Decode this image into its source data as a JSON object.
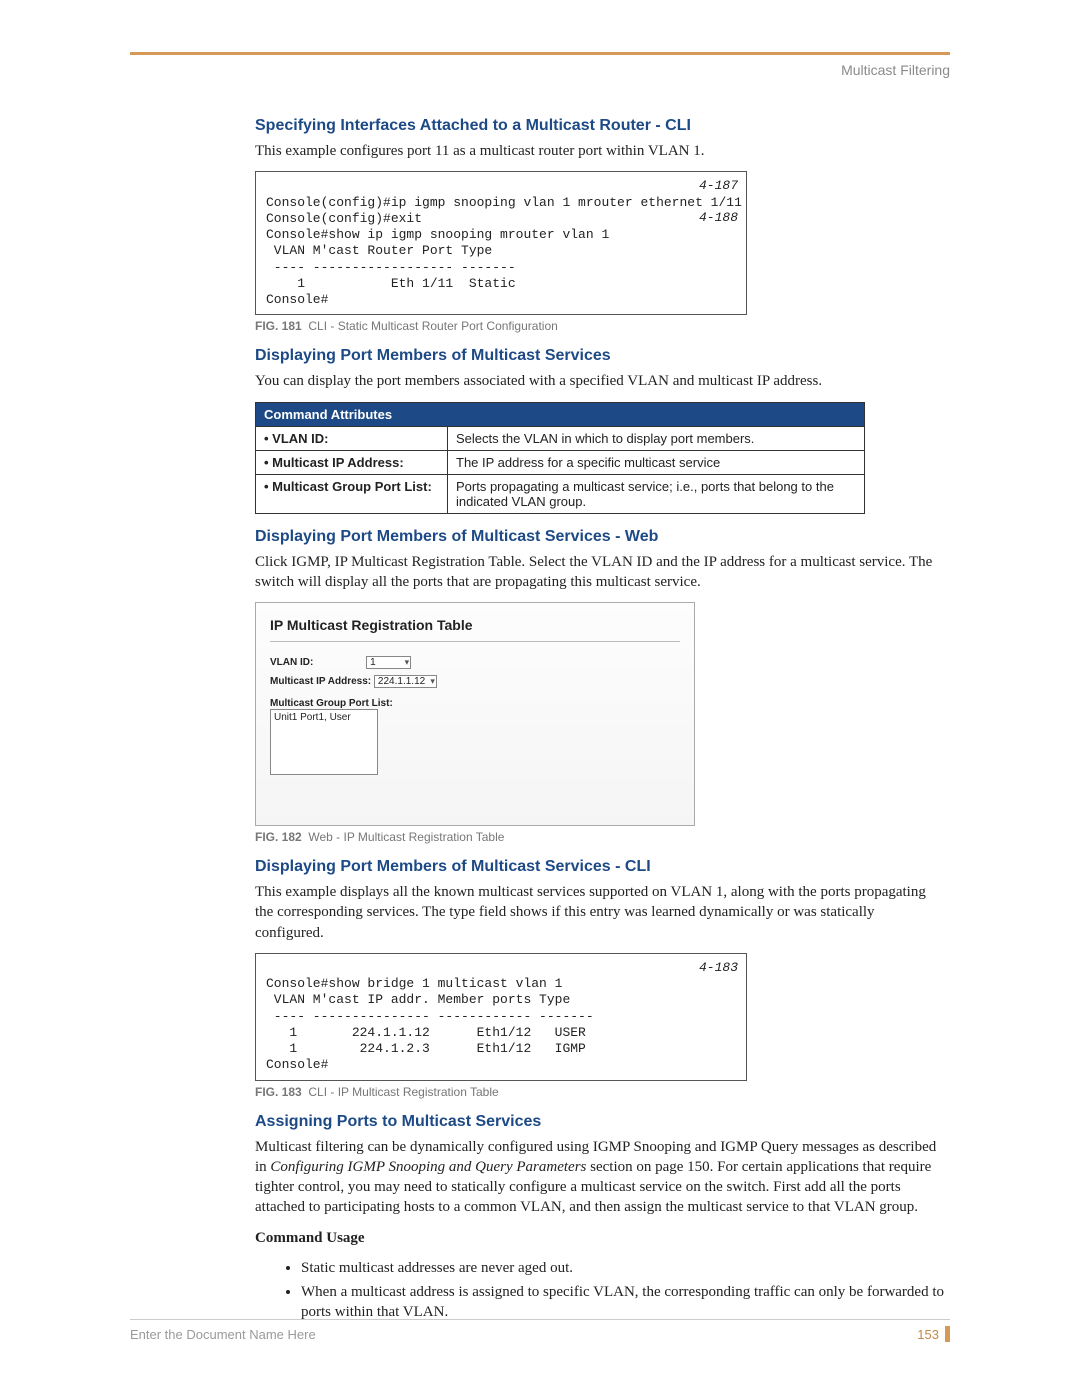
{
  "header": {
    "section": "Multicast Filtering"
  },
  "sec1": {
    "title": "Specifying Interfaces Attached to a Multicast Router - CLI",
    "intro": "This example configures port 11 as a multicast router port within VLAN 1.",
    "code": {
      "l1": "Console(config)#ip igmp snooping vlan 1 mrouter ethernet 1/11",
      "r1": "4-187",
      "l2": "Console(config)#exit",
      "l3": "Console#show ip igmp snooping mrouter vlan 1",
      "r3": "4-188",
      "l4": " VLAN M'cast Router Port Type",
      "l5": " ---- ------------------ -------",
      "l6": "    1           Eth 1/11  Static",
      "l7": "Console#"
    },
    "fig": {
      "no": "FIG. 181",
      "cap": "CLI - Static Multicast Router Port Configuration"
    }
  },
  "sec2": {
    "title": "Displaying Port Members of Multicast Services",
    "intro": "You can display the port members associated with a specified VLAN and multicast IP address.",
    "tableHeader": "Command Attributes",
    "rows": [
      {
        "label": "• VLAN ID:",
        "desc": "Selects the VLAN in which to display port members."
      },
      {
        "label": "• Multicast IP Address:",
        "desc": "The IP address for a specific multicast service"
      },
      {
        "label": "• Multicast Group Port List:",
        "desc": "Ports propagating a multicast service; i.e., ports that belong to the indicated VLAN group."
      }
    ]
  },
  "sec3": {
    "title": "Displaying Port Members of Multicast Services - Web",
    "intro": "Click IGMP, IP Multicast Registration Table. Select the VLAN ID and the IP address for a multicast service. The switch will display all the ports that are propagating this multicast service.",
    "web": {
      "title": "IP Multicast Registration Table",
      "vlanLabel": "VLAN ID:",
      "vlanValue": "1",
      "ipLabel": "Multicast IP Address:",
      "ipValue": "224.1.1.12",
      "listLabel": "Multicast Group Port List:",
      "listValue": "Unit1 Port1, User"
    },
    "fig": {
      "no": "FIG. 182",
      "cap": "Web - IP Multicast Registration Table"
    }
  },
  "sec4": {
    "title": "Displaying Port Members of Multicast Services - CLI",
    "intro": "This example displays all the known multicast services supported on VLAN 1, along with the ports propagating the corresponding services. The type field shows if this entry was learned dynamically or was statically configured.",
    "code": {
      "l1": "Console#show bridge 1 multicast vlan 1",
      "r1": "4-183",
      "l2": " VLAN M'cast IP addr. Member ports Type",
      "l3": " ---- --------------- ------------ -------",
      "l4": "   1       224.1.1.12      Eth1/12   USER",
      "l5": "   1        224.1.2.3      Eth1/12   IGMP",
      "l6": "Console#"
    },
    "fig": {
      "no": "FIG. 183",
      "cap": "CLI - IP Multicast Registration Table"
    }
  },
  "sec5": {
    "title": "Assigning Ports to Multicast Services",
    "para_a": "Multicast filtering can be dynamically configured using IGMP Snooping and IGMP Query messages as described in ",
    "para_ital": "Configuring IGMP Snooping and Query Parameters",
    "para_b": " section on page 150. For certain applications that require tighter control, you may need to statically configure a multicast service on the switch. First add all the ports attached to participating hosts to a common VLAN, and then assign the multicast service to that VLAN group.",
    "usageTitle": "Command Usage",
    "bullets": [
      "Static multicast addresses are never aged out.",
      "When a multicast address is assigned to specific VLAN, the corresponding traffic can only be forwarded to ports within that VLAN."
    ]
  },
  "footer": {
    "docname": "Enter the Document Name Here",
    "page": "153"
  }
}
